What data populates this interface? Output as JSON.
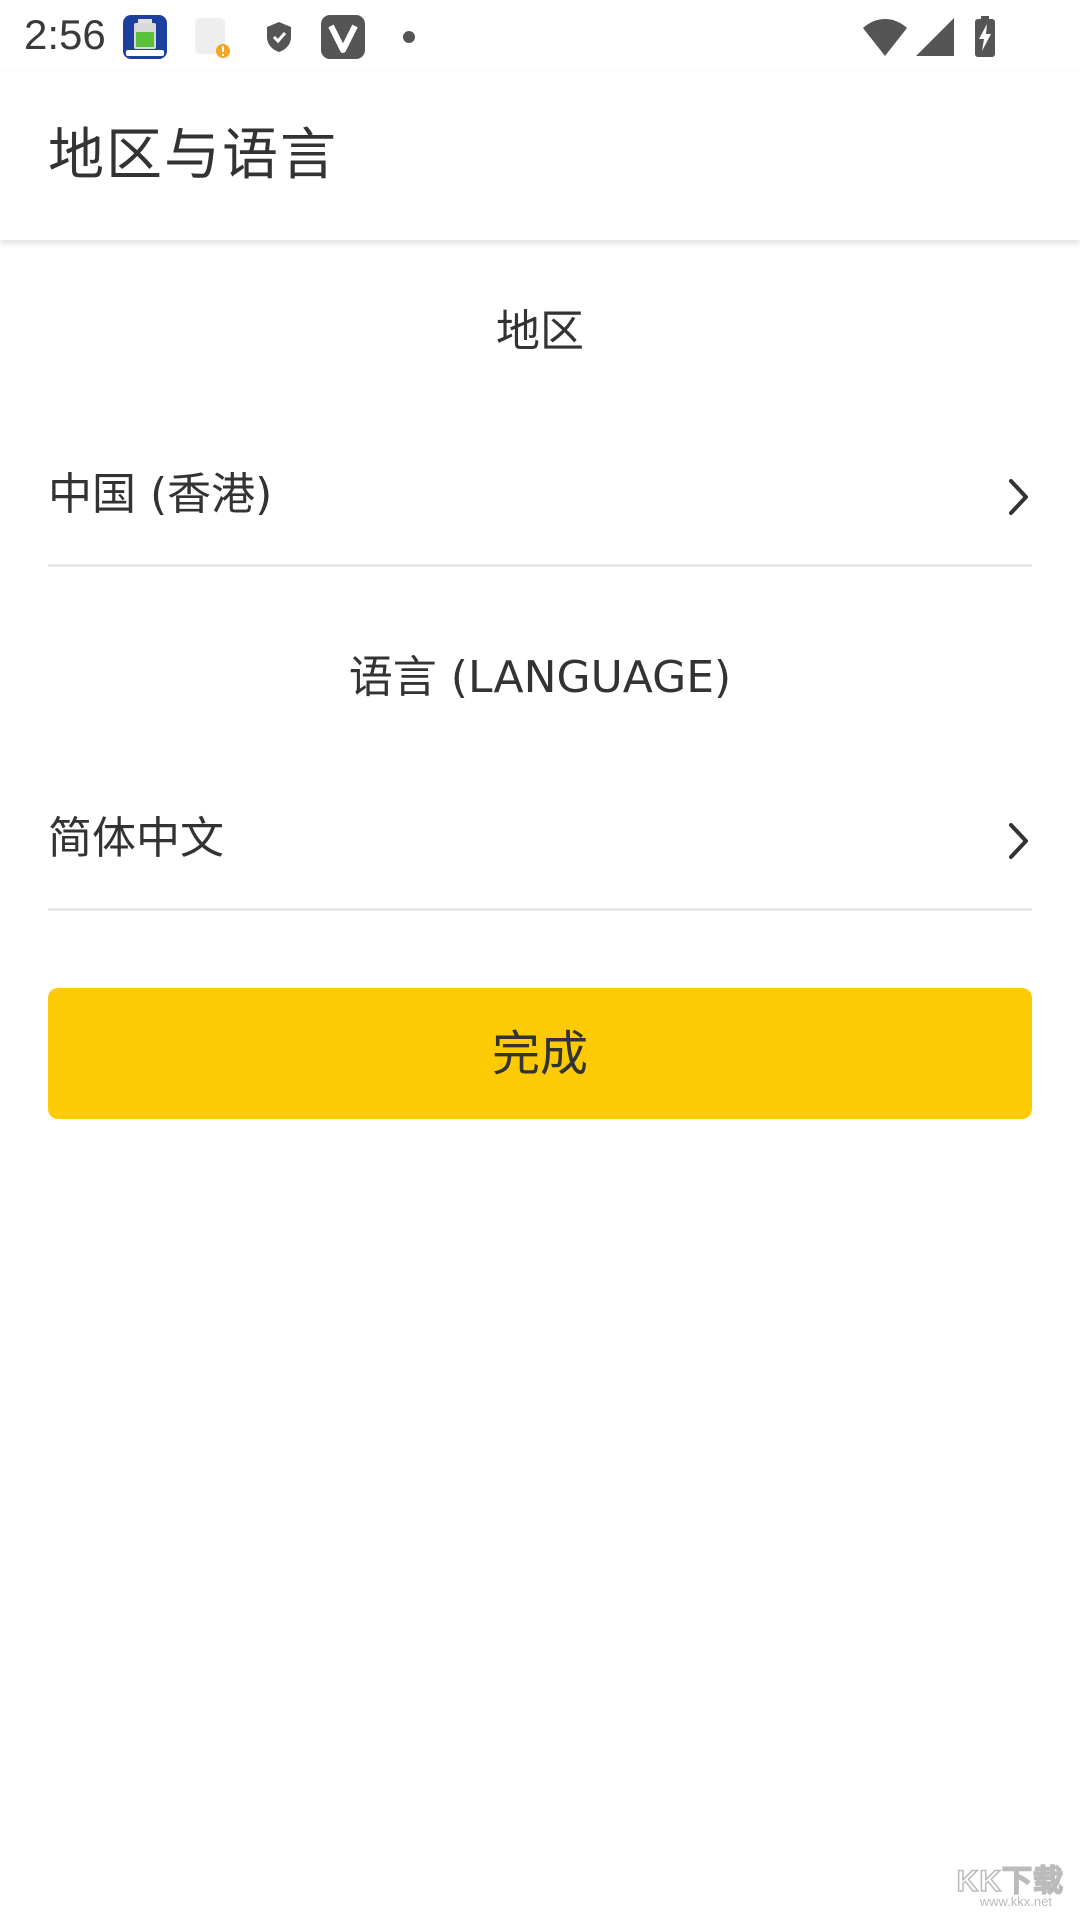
{
  "status_bar": {
    "time": "2:56",
    "left_icons": [
      "battery-app-icon",
      "notification-warning-icon",
      "shield-icon",
      "v-app-icon",
      "dot-icon"
    ],
    "right_icons": [
      "wifi-icon",
      "cellular-signal-icon",
      "battery-charging-icon"
    ]
  },
  "app_bar": {
    "title": "地区与语言"
  },
  "region_section": {
    "header": "地区",
    "value": "中国 (香港)"
  },
  "language_section": {
    "header": "语言 (LANGUAGE)",
    "value": "简体中文"
  },
  "done_button": {
    "label": "完成",
    "color": "#fccb05"
  },
  "watermark": {
    "text": "KK下载",
    "sub": "www.kkx.net"
  }
}
